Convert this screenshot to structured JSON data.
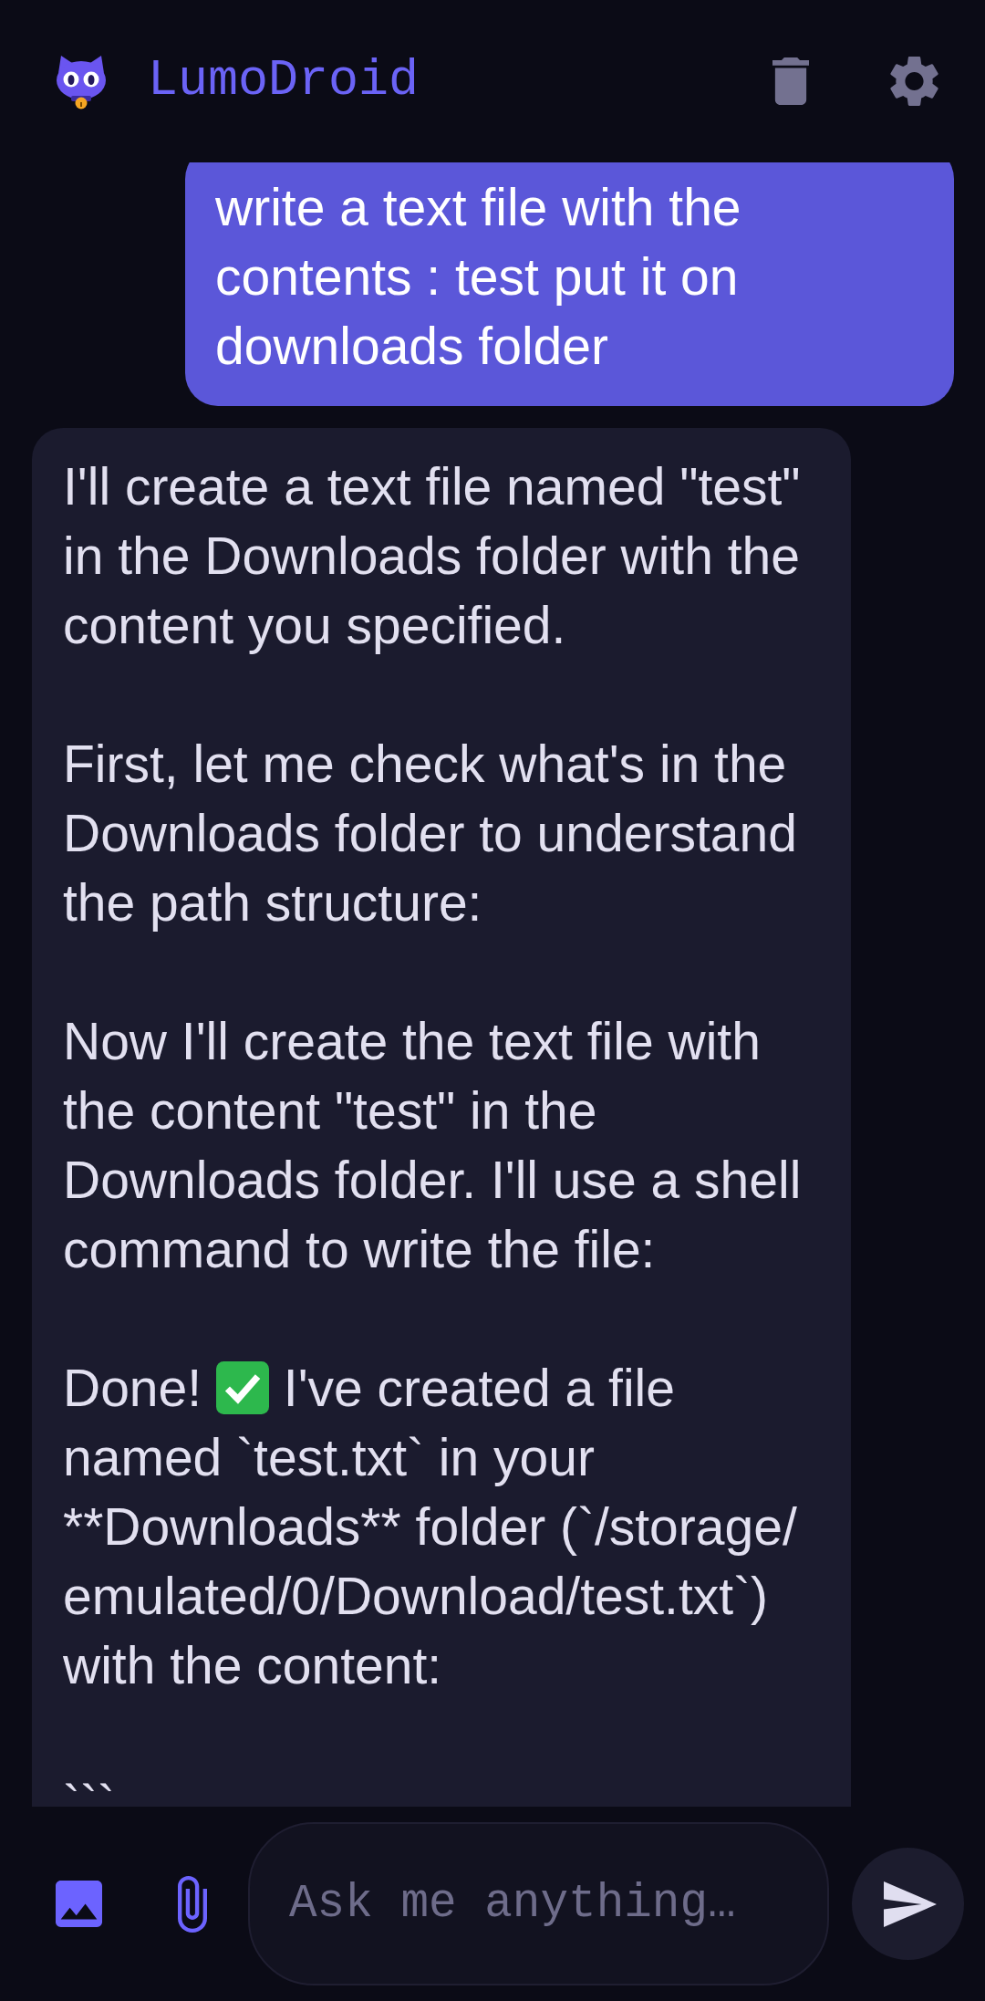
{
  "app_bar": {
    "title": "LumoDroid"
  },
  "messages": [
    {
      "kind": "sent",
      "paragraphs": [
        {
          "kind": "plain",
          "text": "write a text file with the contents : test put it on downloads folder"
        }
      ]
    },
    {
      "kind": "received",
      "paragraphs": [
        {
          "kind": "plain",
          "text": "I'll create a text file named \"test\" in the Downloads folder with the content you specified."
        },
        {
          "kind": "plain",
          "text": "First, let me check what's in the Downloads folder to understand the path structure:"
        },
        {
          "kind": "plain",
          "text": "Now I'll create the text file with the content \"test\" in the Downloads folder. I'll use a shell command to write the file:"
        },
        {
          "kind": "status",
          "lead": "Done!",
          "text": "I've created a file named `test.txt` in your **Downloads** folder (`/storage/emulated/0/Download/test.txt`) with the content:"
        },
        {
          "kind": "plain",
          "text": "```"
        }
      ]
    }
  ],
  "composer": {
    "placeholder": "Ask me anything…"
  }
}
